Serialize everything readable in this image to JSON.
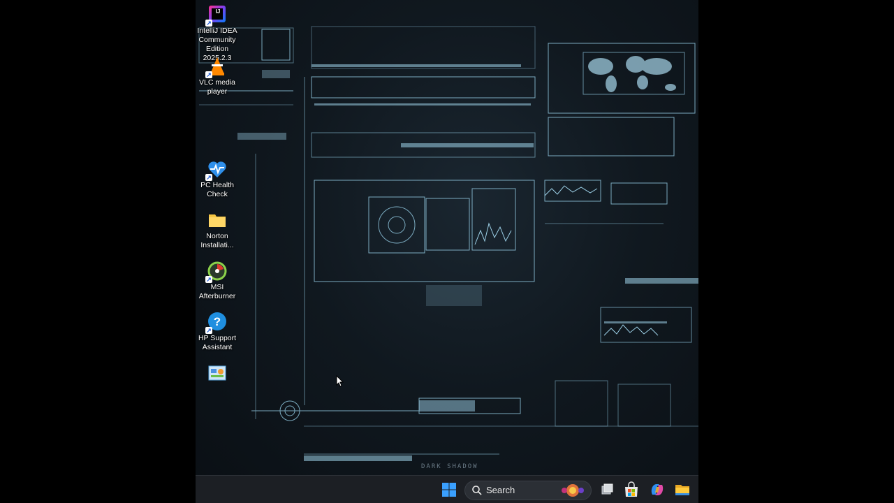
{
  "desktop": {
    "icons": [
      {
        "name": "intellij-idea-icon",
        "label": "IntelliJ IDEA Community Edition 2025.2.3"
      },
      {
        "name": "vlc-icon",
        "label": "VLC media player"
      },
      {
        "name": "pc-health-check-icon",
        "label": "PC Health Check"
      },
      {
        "name": "folder-icon",
        "label": "Norton Installati..."
      },
      {
        "name": "msi-afterburner-icon",
        "label": "MSI Afterburner"
      },
      {
        "name": "hp-support-icon",
        "label": "HP Support Assistant"
      },
      {
        "name": "control-panel-icon",
        "label": ""
      }
    ],
    "watermark": "DARK SHADOW"
  },
  "taskbar": {
    "search_placeholder": "Search",
    "icons": [
      "windows-start-icon",
      "search-icon",
      "task-view-icon",
      "microsoft-store-icon",
      "copilot-icon",
      "file-explorer-icon"
    ]
  },
  "colors": {
    "taskbar_bg": "#1c1f24",
    "hud_accent": "#9fd3ea",
    "windows_blue": "#3aa0ff"
  }
}
